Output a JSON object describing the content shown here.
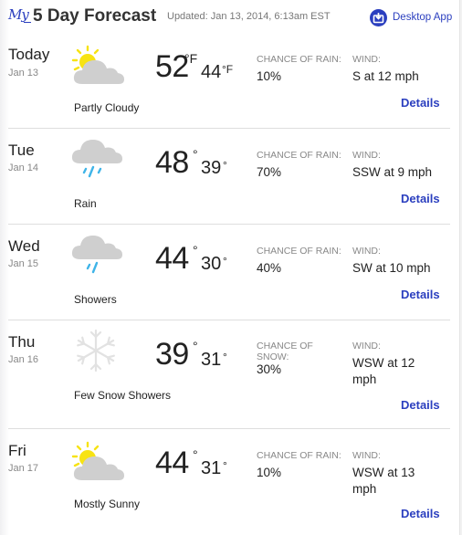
{
  "header": {
    "logo_prefix": "My",
    "title": "5 Day Forecast",
    "updated": "Updated: Jan 13, 2014, 6:13am EST",
    "desktop_app_label": "Desktop App",
    "accent_color": "#2b3fbf"
  },
  "days": [
    {
      "name": "Today",
      "date": "Jan 13",
      "icon": "partly-cloudy-icon",
      "condition": "Partly Cloudy",
      "high": "52",
      "high_unit": "°F",
      "low": "44",
      "low_unit": "°F",
      "chance_label": "CHANCE OF RAIN:",
      "chance": "10%",
      "wind_label": "WIND:",
      "wind": "S at 12 mph",
      "details": "Details"
    },
    {
      "name": "Tue",
      "date": "Jan 14",
      "icon": "rain-icon",
      "condition": "Rain",
      "high": "48",
      "high_unit": "°",
      "low": "39",
      "low_unit": "°",
      "chance_label": "CHANCE OF RAIN:",
      "chance": "70%",
      "wind_label": "WIND:",
      "wind": "SSW at 9 mph",
      "details": "Details"
    },
    {
      "name": "Wed",
      "date": "Jan 15",
      "icon": "showers-icon",
      "condition": "Showers",
      "high": "44",
      "high_unit": "°",
      "low": "30",
      "low_unit": "°",
      "chance_label": "CHANCE OF RAIN:",
      "chance": "40%",
      "wind_label": "WIND:",
      "wind": "SW at 10 mph",
      "details": "Details"
    },
    {
      "name": "Thu",
      "date": "Jan 16",
      "icon": "snowflake-icon",
      "condition": "Few Snow Showers",
      "high": "39",
      "high_unit": "°",
      "low": "31",
      "low_unit": "°",
      "chance_label": "CHANCE OF SNOW:",
      "chance": "30%",
      "wind_label": "WIND:",
      "wind": "WSW at 12 mph",
      "details": "Details"
    },
    {
      "name": "Fri",
      "date": "Jan 17",
      "icon": "mostly-sunny-icon",
      "condition": "Mostly Sunny",
      "high": "44",
      "high_unit": "°",
      "low": "31",
      "low_unit": "°",
      "chance_label": "CHANCE OF RAIN:",
      "chance": "10%",
      "wind_label": "WIND:",
      "wind": "WSW at 13 mph",
      "details": "Details"
    }
  ]
}
